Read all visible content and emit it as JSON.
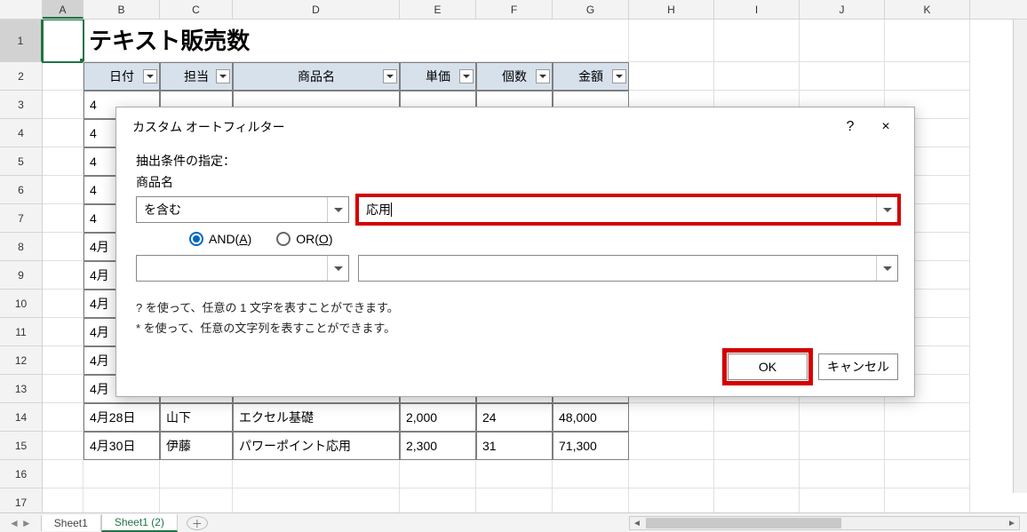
{
  "sheet": {
    "columns": [
      "A",
      "B",
      "C",
      "D",
      "E",
      "F",
      "G",
      "H",
      "I",
      "J",
      "K"
    ],
    "title_cell": "テキスト販売数",
    "headers": {
      "date": "日付",
      "person": "担当",
      "product": "商品名",
      "price": "単価",
      "qty": "個数",
      "amount": "金額"
    },
    "row3_b": "4",
    "rows_partial": {
      "r4": "4",
      "r5": "4",
      "r6": "4",
      "r7": "4",
      "r8": "4月",
      "r9": "4月",
      "r10": "4月",
      "r11": "4月",
      "r12": "4月",
      "r13": "4月"
    },
    "row14": {
      "date": "4月28日",
      "person": "山下",
      "product": "エクセル基礎",
      "price": "2,000",
      "qty": "24",
      "amount": "48,000"
    },
    "row15": {
      "date": "4月30日",
      "person": "伊藤",
      "product": "パワーポイント応用",
      "price": "2,300",
      "qty": "31",
      "amount": "71,300"
    },
    "row_numbers": [
      1,
      2,
      3,
      4,
      5,
      6,
      7,
      8,
      9,
      10,
      11,
      12,
      13,
      14,
      15,
      16,
      17
    ],
    "tabs": {
      "sheet1": "Sheet1",
      "sheet1_2": "Sheet1 (2)"
    }
  },
  "dialog": {
    "title": "カスタム オートフィルター",
    "help_icon": "?",
    "close_icon": "×",
    "cond_label": "抽出条件の指定：",
    "field_label": "商品名",
    "op1": "を含む",
    "val1": "応用",
    "and_label_pre": "AND(",
    "and_label_u": "A",
    "and_label_post": ")",
    "or_label_pre": "OR(",
    "or_label_u": "O",
    "or_label_post": ")",
    "op2": "",
    "val2": "",
    "hint1": "? を使って、任意の 1 文字を表すことができます。",
    "hint2": "* を使って、任意の文字列を表すことができます。",
    "ok": "OK",
    "cancel": "キャンセル"
  }
}
